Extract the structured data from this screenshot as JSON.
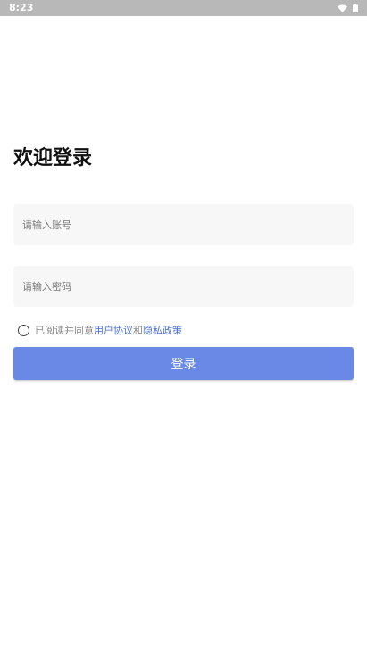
{
  "status_bar": {
    "time": "8:23",
    "icons": [
      "wifi-icon",
      "battery-icon"
    ]
  },
  "login": {
    "title": "欢迎登录",
    "account": {
      "placeholder": "请输入账号",
      "value": ""
    },
    "password": {
      "placeholder": "请输入密码",
      "value": ""
    },
    "agreement": {
      "checked": false,
      "prefix": "已阅读并同意",
      "user_agreement": "用户协议",
      "conjunction": "和",
      "privacy_policy": "隐私政策"
    },
    "button_label": "登录"
  },
  "colors": {
    "status_bar": "#b8b8b8",
    "input_background": "#f7f7f7",
    "link": "#4a6fd6",
    "button": "#6a89e6"
  }
}
